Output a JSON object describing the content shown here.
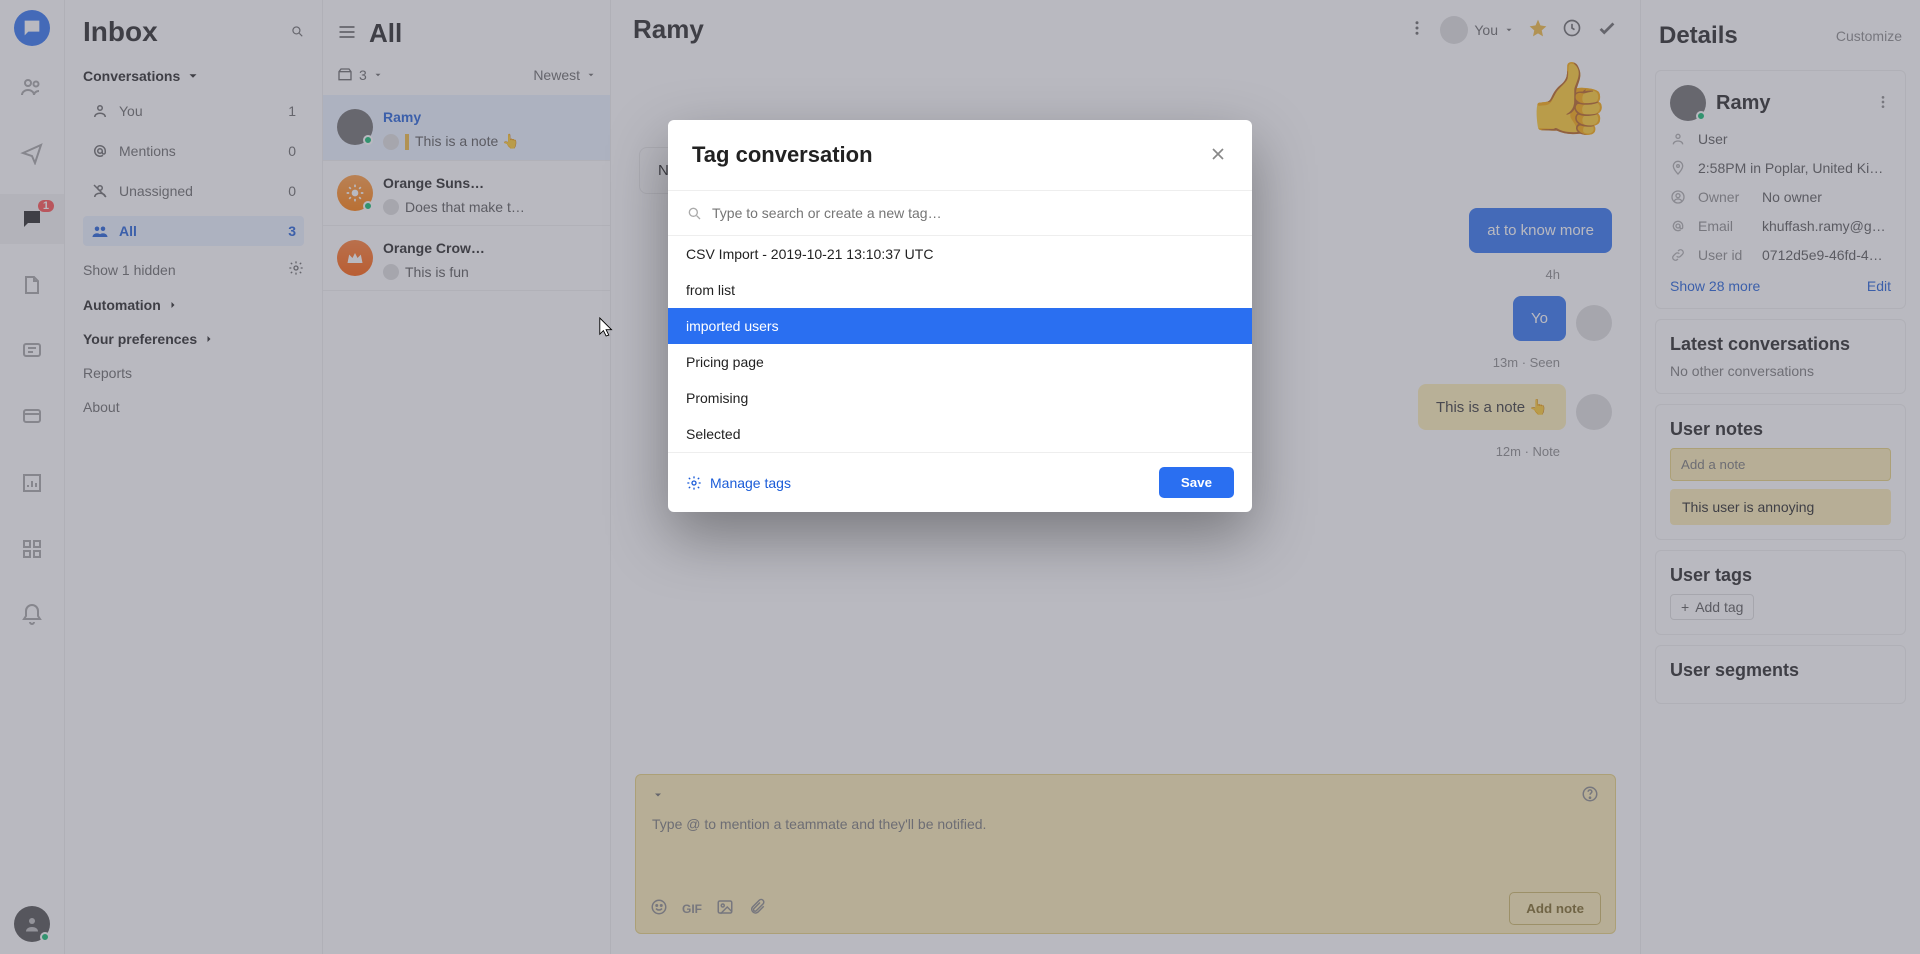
{
  "navrail": {
    "badge": "1"
  },
  "folders": {
    "title": "Inbox",
    "conversations_label": "Conversations",
    "items": {
      "you": {
        "label": "You",
        "count": "1"
      },
      "mentions": {
        "label": "Mentions",
        "count": "0"
      },
      "unassigned": {
        "label": "Unassigned",
        "count": "0"
      },
      "all": {
        "label": "All",
        "count": "3"
      }
    },
    "show_hidden": "Show 1 hidden",
    "automation": "Automation",
    "preferences": "Your preferences",
    "reports": "Reports",
    "about": "About"
  },
  "conv_list": {
    "header": "All",
    "open_count": "3",
    "sort": "Newest",
    "items": {
      "ramy": {
        "name": "Ramy",
        "preview": "This is a note 👆",
        "has_notebar": true
      },
      "sunset": {
        "name": "Orange Suns…",
        "preview": "Does that make t…"
      },
      "crown": {
        "name": "Orange Crow…",
        "preview": "This is fun"
      }
    }
  },
  "thread": {
    "title": "Ramy",
    "assignee_label": "You",
    "messages": {
      "noice": {
        "text": "Noice",
        "side": "left"
      },
      "want_more": {
        "text": "at to know more",
        "side": "right",
        "meta": "4h"
      },
      "yo": {
        "text": "Yo",
        "side": "right",
        "meta": "13m · Seen"
      },
      "note": {
        "text": "This is a note 👆",
        "side": "right",
        "meta": "12m · Note"
      }
    },
    "composer": {
      "placeholder": "Type @ to mention a teammate and they'll be notified.",
      "gif": "GIF",
      "send": "Add note"
    }
  },
  "details": {
    "title": "Details",
    "customize": "Customize",
    "user": {
      "name": "Ramy",
      "role": "User",
      "location": "2:58PM in Poplar, United Ki…",
      "owner_label": "Owner",
      "owner_value": "No owner",
      "email_label": "Email",
      "email_value": "khuffash.ramy@gm…",
      "userid_label": "User id",
      "userid_value": "0712d5e9-46fd-4…",
      "show_more": "Show 28 more",
      "edit": "Edit"
    },
    "latest": {
      "title": "Latest conversations",
      "empty": "No other conversations"
    },
    "notes": {
      "title": "User notes",
      "placeholder": "Add a note",
      "value": "This user is annoying"
    },
    "tags": {
      "title": "User tags",
      "add": "Add tag"
    },
    "segments": {
      "title": "User segments"
    }
  },
  "modal": {
    "title": "Tag conversation",
    "search_placeholder": "Type to search or create a new tag…",
    "options": {
      "csv": "CSV Import - 2019-10-21 13:10:37 UTC",
      "from_list": "from list",
      "imported": "imported users",
      "pricing": "Pricing page",
      "promising": "Promising",
      "selected": "Selected"
    },
    "manage": "Manage tags",
    "save": "Save"
  }
}
